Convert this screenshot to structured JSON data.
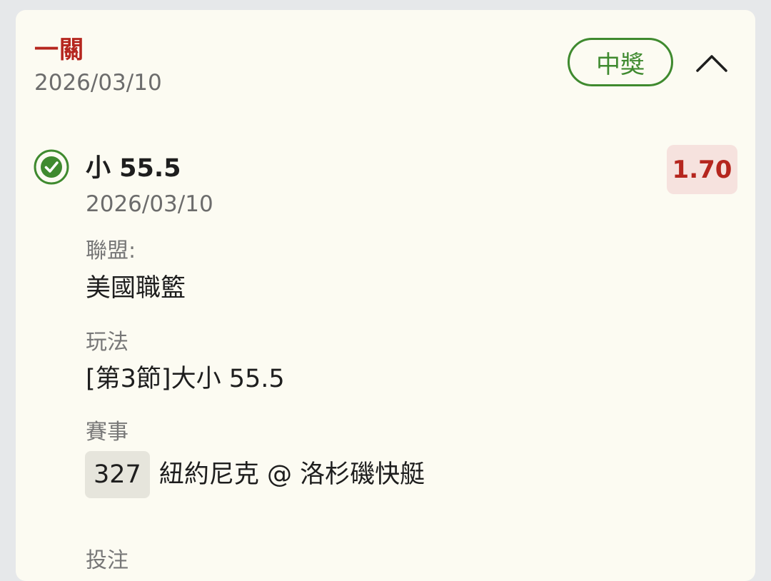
{
  "bet": {
    "type_label": "一關",
    "date": "2026/03/10",
    "status": "中獎"
  },
  "selection": {
    "pick": "小 55.5",
    "date": "2026/03/10",
    "odds": "1.70"
  },
  "fields": {
    "league_label": "聯盟:",
    "league_value": "美國職籃",
    "market_label": "玩法",
    "market_value": "[第3節]大小 55.5",
    "event_label": "賽事",
    "event_id": "327",
    "event_name": "紐約尼克 @ 洛杉磯快艇",
    "next_label": "投注"
  },
  "colors": {
    "accent_red": "#b5261e",
    "win_green": "#3f8a2f",
    "card_bg": "#fcfbf2",
    "page_bg": "#e6e8ea"
  },
  "icons": {
    "check": "check-circle-icon",
    "collapse": "chevron-up-icon"
  }
}
